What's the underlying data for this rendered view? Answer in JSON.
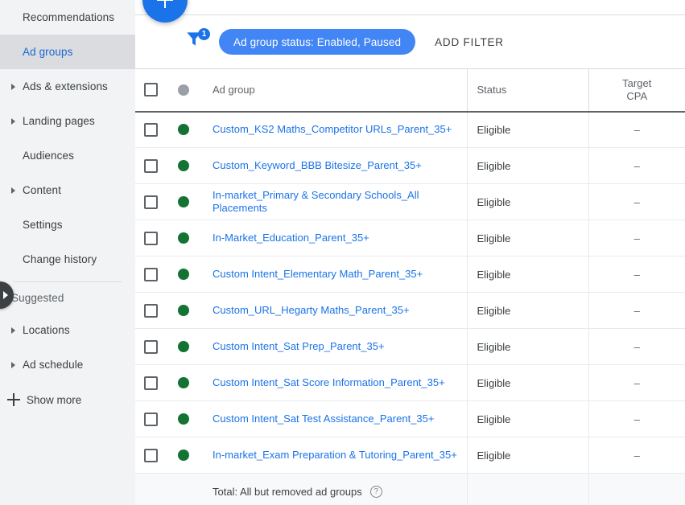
{
  "sidebar": {
    "items": [
      {
        "label": "Recommendations",
        "expandable": false,
        "selected": false
      },
      {
        "label": "Ad groups",
        "expandable": false,
        "selected": true
      },
      {
        "label": "Ads & extensions",
        "expandable": true,
        "selected": false
      },
      {
        "label": "Landing pages",
        "expandable": true,
        "selected": false
      },
      {
        "label": "Audiences",
        "expandable": false,
        "selected": false
      },
      {
        "label": "Content",
        "expandable": true,
        "selected": false
      },
      {
        "label": "Settings",
        "expandable": false,
        "selected": false
      },
      {
        "label": "Change history",
        "expandable": false,
        "selected": false
      }
    ],
    "section_title": "Suggested",
    "suggested_items": [
      {
        "label": "Locations",
        "expandable": true
      },
      {
        "label": "Ad schedule",
        "expandable": true
      }
    ],
    "show_more": "Show more",
    "collapse_icon": "chevron-right-icon"
  },
  "toolbar": {
    "fab_icon": "plus-icon",
    "filter_icon": "filter-funnel-icon",
    "filter_badge": "1",
    "filter_chip": "Ad group status: Enabled, Paused",
    "add_filter": "ADD FILTER"
  },
  "table": {
    "headers": {
      "checkbox": "select-all",
      "status_dot": "status-dot",
      "ad_group": "Ad group",
      "status": "Status",
      "target_cpa_line1": "Target",
      "target_cpa_line2": "CPA"
    },
    "rows": [
      {
        "name": "Custom_KS2 Maths_Competitor URLs_Parent_35+",
        "status": "Eligible",
        "state": "enabled",
        "target_cpa": "–"
      },
      {
        "name": "Custom_Keyword_BBB Bitesize_Parent_35+",
        "status": "Eligible",
        "state": "enabled",
        "target_cpa": "–"
      },
      {
        "name": "In-market_Primary & Secondary Schools_All Placements",
        "status": "Eligible",
        "state": "enabled",
        "target_cpa": "–"
      },
      {
        "name": "In-Market_Education_Parent_35+",
        "status": "Eligible",
        "state": "enabled",
        "target_cpa": "–"
      },
      {
        "name": "Custom Intent_Elementary Math_Parent_35+",
        "status": "Eligible",
        "state": "enabled",
        "target_cpa": "–"
      },
      {
        "name": "Custom_URL_Hegarty Maths_Parent_35+",
        "status": "Eligible",
        "state": "enabled",
        "target_cpa": "–"
      },
      {
        "name": "Custom Intent_Sat Prep_Parent_35+",
        "status": "Eligible",
        "state": "enabled",
        "target_cpa": "–"
      },
      {
        "name": "Custom Intent_Sat Score Information_Parent_35+",
        "status": "Eligible",
        "state": "enabled",
        "target_cpa": "–"
      },
      {
        "name": "Custom Intent_Sat Test Assistance_Parent_35+",
        "status": "Eligible",
        "state": "enabled",
        "target_cpa": "–"
      },
      {
        "name": "In-market_Exam Preparation & Tutoring_Parent_35+",
        "status": "Eligible",
        "state": "enabled",
        "target_cpa": "–"
      }
    ],
    "total": {
      "label": "Total: All but removed ad groups",
      "help_icon": "help-circle-icon",
      "help_glyph": "?",
      "status": "",
      "target_cpa": ""
    }
  },
  "colors": {
    "accent_blue": "#1a73e8",
    "chip_blue": "#4285f4",
    "enabled_green": "#137333",
    "header_dot_gray": "#9aa0a6",
    "sidebar_bg": "#f1f3f4",
    "sidebar_selected": "#dadce0",
    "link_blue": "#1a73e8"
  }
}
